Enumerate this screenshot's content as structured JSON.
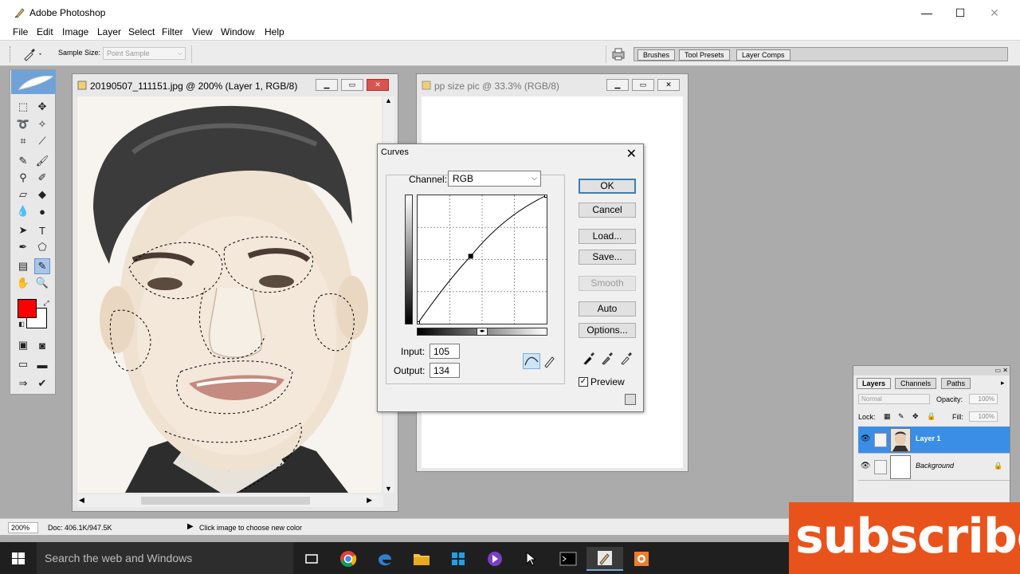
{
  "app": {
    "title": "Adobe Photoshop",
    "window_controls": {
      "minimize": "—",
      "maximize": "☐",
      "close": "✕"
    }
  },
  "menu": [
    "File",
    "Edit",
    "Image",
    "Layer",
    "Select",
    "Filter",
    "View",
    "Window",
    "Help"
  ],
  "options_bar": {
    "sample_size_label": "Sample Size:",
    "sample_size_value": "Point Sample",
    "palette_tabs": [
      "Brushes",
      "Tool Presets",
      "Layer Comps"
    ]
  },
  "toolbox": {
    "foreground_color": "#ff0000",
    "background_color": "#ffffff",
    "active_tool": "eyedropper"
  },
  "documents": [
    {
      "title": "20190507_111151.jpg @ 200% (Layer 1, RGB/8)",
      "active": true
    },
    {
      "title": "pp size pic @ 33.3% (RGB/8)",
      "active": false
    }
  ],
  "curves": {
    "title": "Curves",
    "channel_label": "Channel:",
    "channel_value": "RGB",
    "input_label": "Input:",
    "input_value": "105",
    "output_label": "Output:",
    "output_value": "134",
    "buttons": {
      "ok": "OK",
      "cancel": "Cancel",
      "load": "Load...",
      "save": "Save...",
      "smooth": "Smooth",
      "auto": "Auto",
      "options": "Options..."
    },
    "preview_label": "Preview",
    "preview_checked": true,
    "curve_points": [
      [
        0,
        0
      ],
      [
        105,
        134
      ],
      [
        255,
        255
      ]
    ]
  },
  "layers_panel": {
    "tabs": [
      "Layers",
      "Channels",
      "Paths"
    ],
    "blend_mode": "Normal",
    "opacity_label": "Opacity:",
    "opacity_value": "100%",
    "lock_label": "Lock:",
    "fill_label": "Fill:",
    "fill_value": "100%",
    "layers": [
      {
        "name": "Layer 1",
        "selected": true
      },
      {
        "name": "Background",
        "selected": false
      }
    ]
  },
  "status_bar": {
    "zoom": "200%",
    "doc_info": "Doc: 406.1K/947.5K",
    "message": "Click image to choose new color"
  },
  "taskbar": {
    "search_placeholder": "Search the web and Windows"
  },
  "overlay": {
    "subscribe_text": "subscribe",
    "color": "#e8531c"
  }
}
